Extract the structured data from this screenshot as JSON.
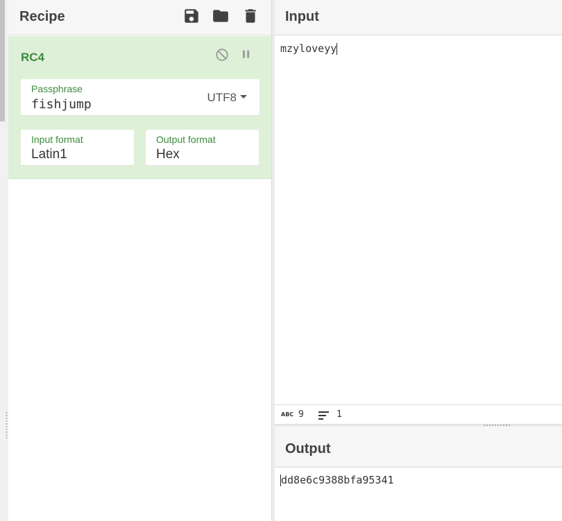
{
  "recipe": {
    "title": "Recipe",
    "icons": [
      "save-icon",
      "folder-icon",
      "trash-icon"
    ]
  },
  "operation": {
    "name": "RC4",
    "passphrase": {
      "label": "Passphrase",
      "value": "fishjump",
      "encoding": "UTF8"
    },
    "input_format": {
      "label": "Input format",
      "value": "Latin1"
    },
    "output_format": {
      "label": "Output format",
      "value": "Hex"
    }
  },
  "input": {
    "title": "Input",
    "text": "mzyloveyy",
    "stats": {
      "length": "9",
      "lines": "1",
      "length_icon_text": "ABC"
    }
  },
  "output": {
    "title": "Output",
    "text": "dd8e6c9388bfa95341"
  },
  "colors": {
    "op_background": "#dff0d8",
    "op_accent": "#3c8a3c",
    "header_background": "#f6f6f6"
  }
}
